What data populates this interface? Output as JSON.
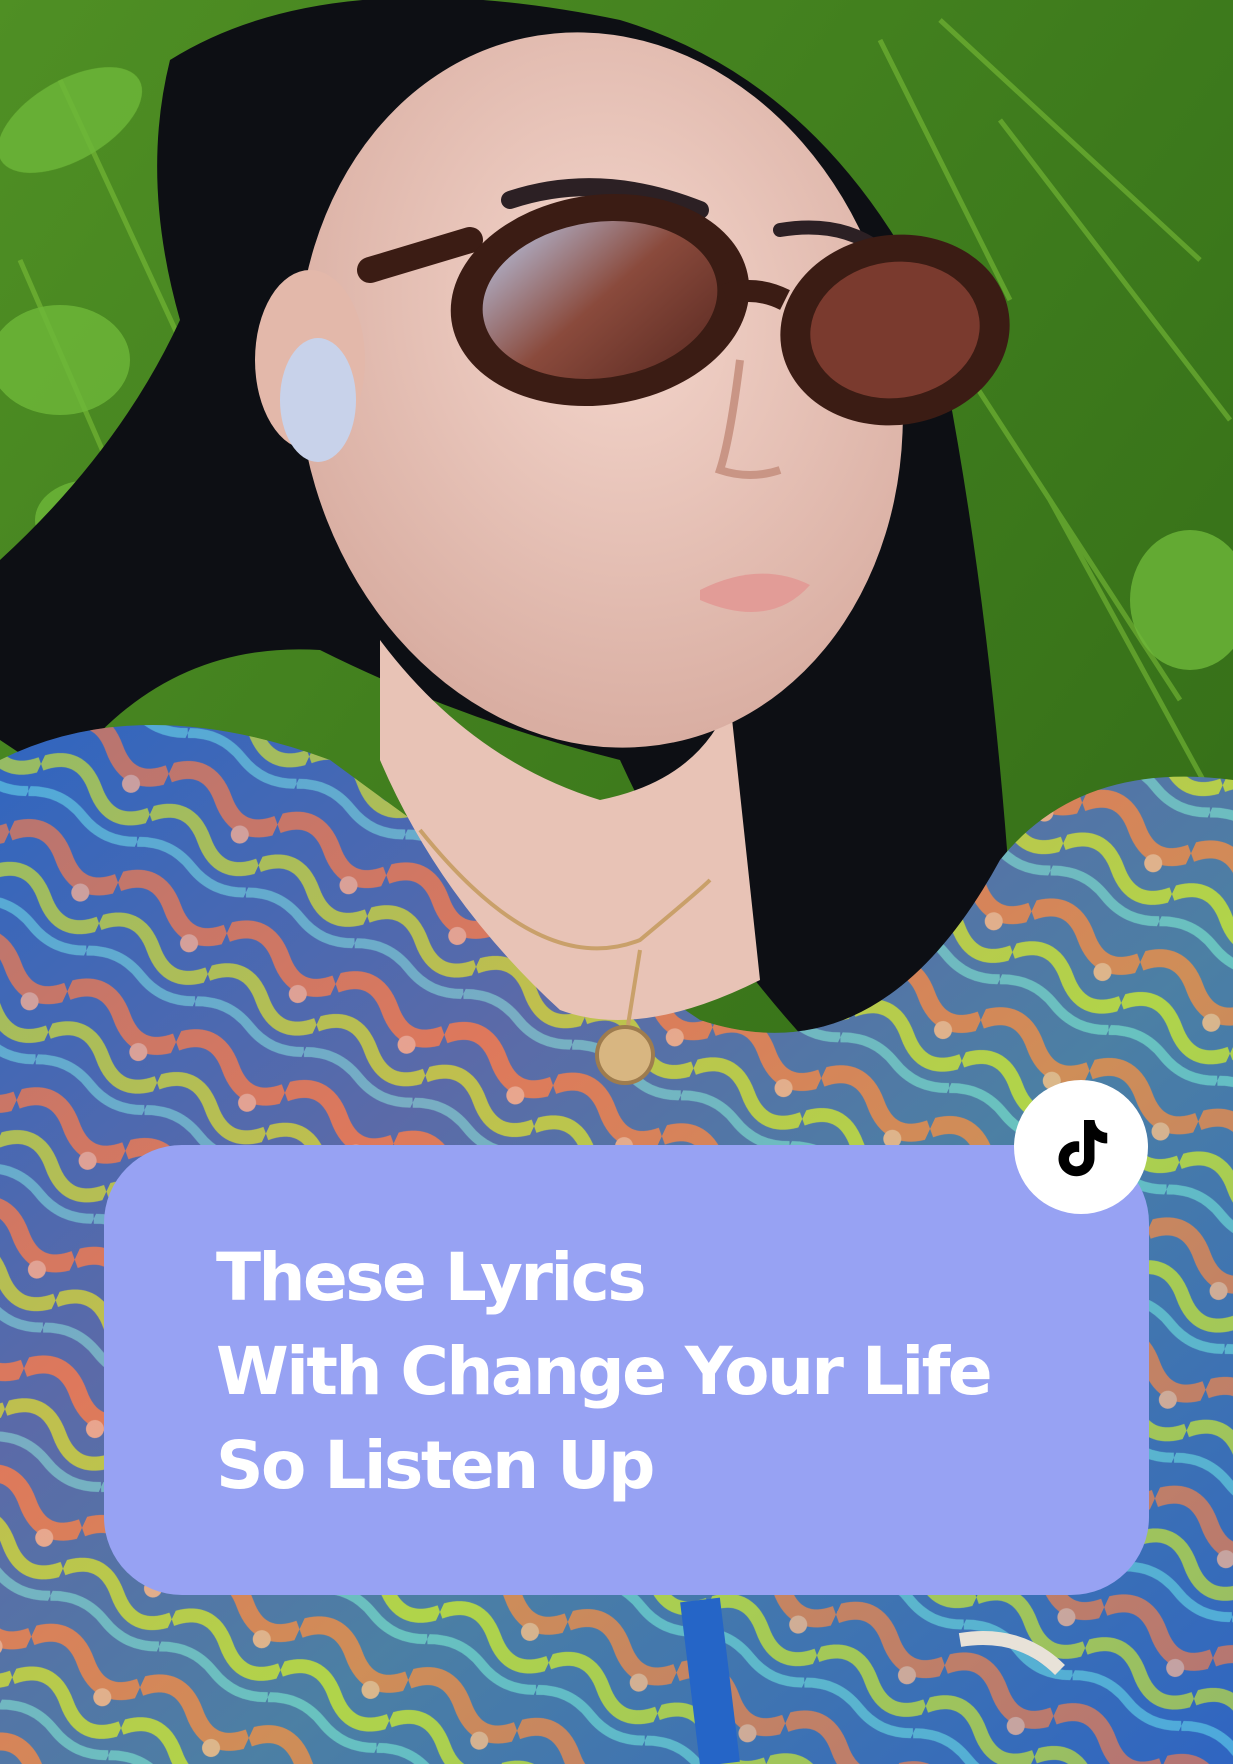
{
  "caption": {
    "lines": [
      "These Lyrics",
      "With Change Your Life",
      "So Listen Up"
    ]
  },
  "badge": {
    "icon": "tiktok-logo-icon"
  },
  "colors": {
    "caption_background": "#97a2f3",
    "caption_text": "#ffffff",
    "badge_background": "#ffffff",
    "badge_icon": "#000000"
  }
}
